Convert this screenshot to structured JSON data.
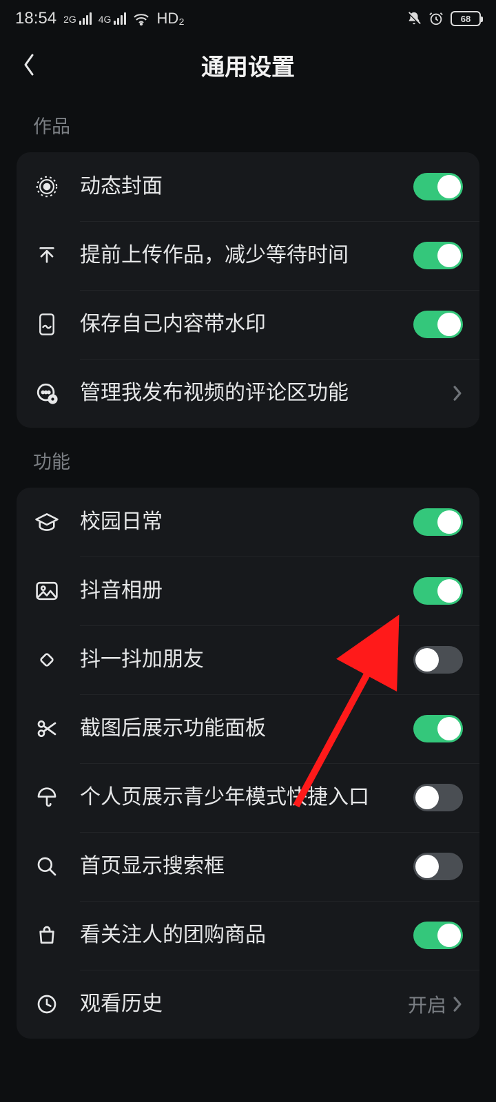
{
  "status": {
    "time": "18:54",
    "net_g2": "2G",
    "net_g4": "4G",
    "hd": "HD₂",
    "battery": "68"
  },
  "header": {
    "title": "通用设置"
  },
  "sections": {
    "works": {
      "title": "作品",
      "items": {
        "dynamic_cover": {
          "label": "动态封面",
          "on": true
        },
        "preupload": {
          "label": "提前上传作品，减少等待时间",
          "on": true
        },
        "watermark": {
          "label": "保存自己内容带水印",
          "on": true
        },
        "manage_comments": {
          "label": "管理我发布视频的评论区功能"
        }
      }
    },
    "features": {
      "title": "功能",
      "items": {
        "campus": {
          "label": "校园日常",
          "on": true
        },
        "album": {
          "label": "抖音相册",
          "on": true
        },
        "shake_friends": {
          "label": "抖一抖加朋友",
          "on": false
        },
        "screenshot_panel": {
          "label": "截图后展示功能面板",
          "on": true
        },
        "teen_shortcut": {
          "label": "个人页展示青少年模式快捷入口",
          "on": false
        },
        "home_search": {
          "label": "首页显示搜索框",
          "on": false
        },
        "follow_group_buy": {
          "label": "看关注人的团购商品",
          "on": true
        },
        "watch_history": {
          "label": "观看历史",
          "value": "开启"
        }
      }
    }
  }
}
